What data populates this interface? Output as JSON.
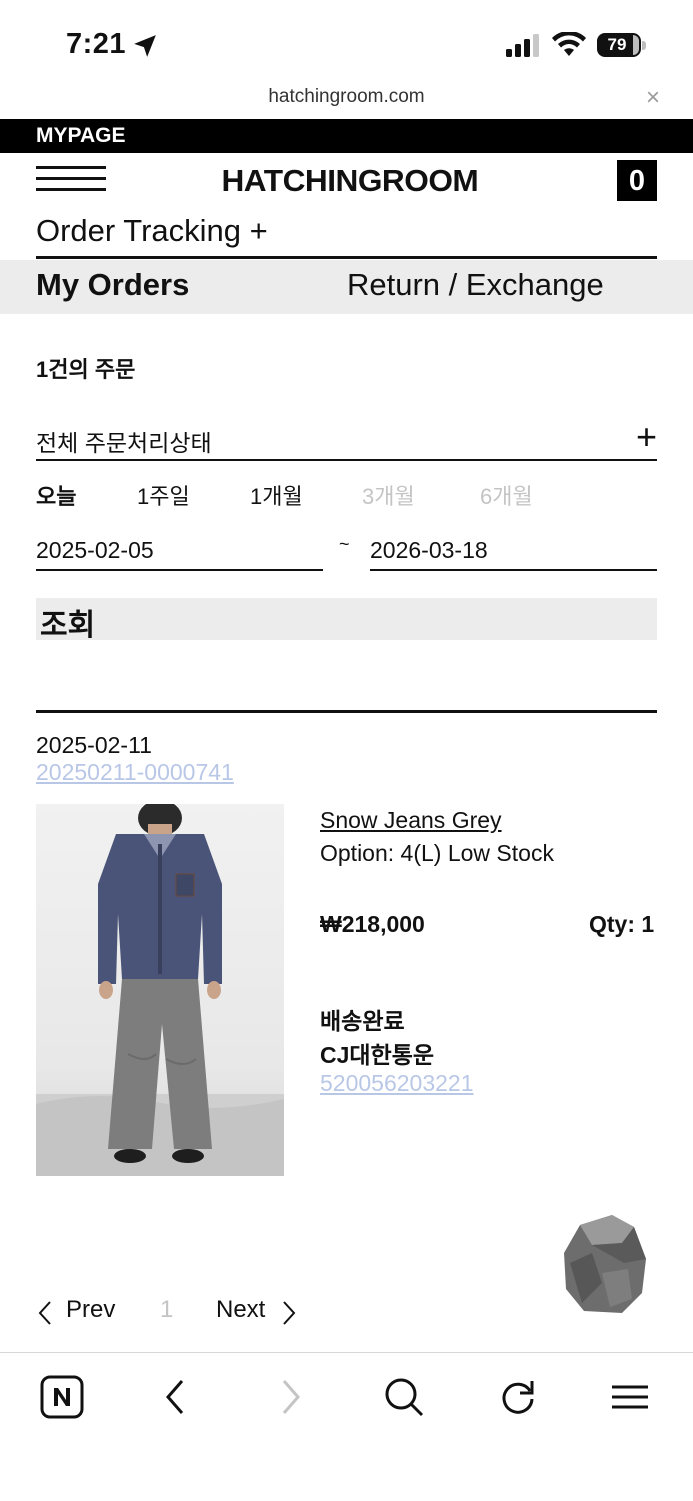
{
  "status_bar": {
    "time": "7:21",
    "battery": "79"
  },
  "browser": {
    "url": "hatchingroom.com",
    "close": "×"
  },
  "header": {
    "mypage": "MYPAGE",
    "brand": "HATCHINGROOM",
    "cart_count": "0"
  },
  "nav": {
    "order_tracking": "Order Tracking +",
    "tabs": [
      {
        "label": "My Orders"
      },
      {
        "label": "Return / Exchange"
      }
    ]
  },
  "filters": {
    "order_count": "1건의 주문",
    "status_select": "전체 주문처리상태",
    "status_plus": "+",
    "periods": [
      {
        "label": "오늘"
      },
      {
        "label": "1주일"
      },
      {
        "label": "1개월"
      },
      {
        "label": "3개월"
      },
      {
        "label": "6개월"
      }
    ],
    "date_from": "2025-02-05",
    "date_sep": "~",
    "date_to": "2026-03-18",
    "search_label": "조회"
  },
  "order": {
    "date": "2025-02-11",
    "number": "20250211-0000741",
    "product": {
      "name": "Snow Jeans Grey",
      "option": "Option: 4(L) Low Stock",
      "price": "₩218,000",
      "qty": "Qty: 1"
    },
    "shipping": {
      "status": "배송완료",
      "carrier": "CJ대한통운",
      "tracking": "520056203221"
    }
  },
  "pagination": {
    "prev": "Prev",
    "page": "1",
    "next": "Next"
  },
  "toolbar": {
    "icons": [
      "naver-icon",
      "back-icon",
      "forward-icon",
      "search-icon",
      "reload-icon",
      "menu-icon"
    ]
  }
}
